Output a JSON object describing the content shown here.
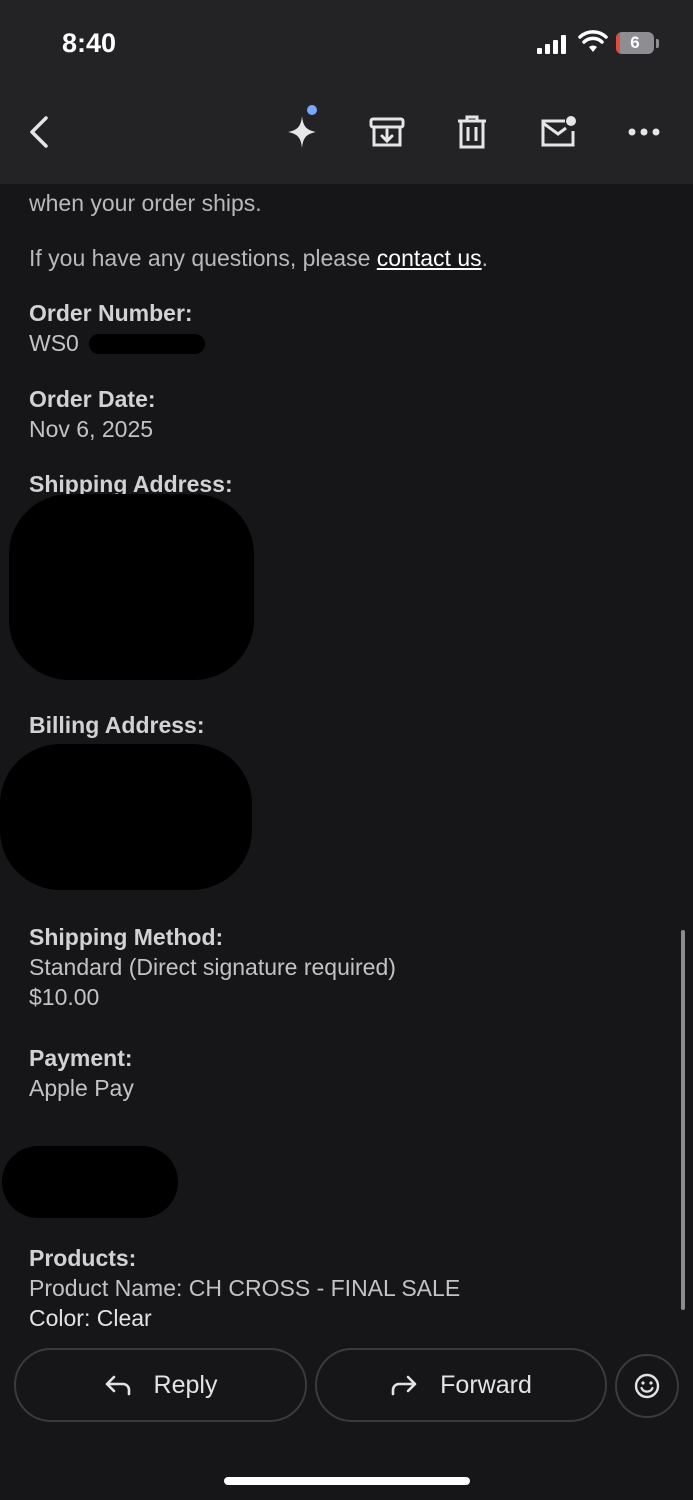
{
  "status": {
    "time": "8:40",
    "battery": "6",
    "battery_level": 0.06
  },
  "toolbar": {
    "icons": [
      "back-icon",
      "gemini-sparkle-icon",
      "archive-icon",
      "trash-icon",
      "mark-unread-icon",
      "more-icon"
    ]
  },
  "email": {
    "partial_line": "when your order ships.",
    "questions_text": "If you have any questions, please ",
    "contact_link": "contact us",
    "questions_end": ".",
    "order_number_label": "Order Number:",
    "order_number_value": "WS0",
    "order_date_label": "Order Date:",
    "order_date_value": "Nov 6, 2025",
    "shipping_address_label": "Shipping Address:",
    "billing_address_label": "Billing Address:",
    "shipping_method_label": "Shipping Method:",
    "shipping_method_value": "Standard (Direct signature required)",
    "shipping_cost": "$10.00",
    "payment_label": "Payment:",
    "payment_value": "Apple Pay",
    "products_label": "Products:",
    "product_name": "Product Name: CH CROSS - FINAL SALE",
    "product_color": "Color: Clear"
  },
  "actions": {
    "reply": "Reply",
    "forward": "Forward"
  },
  "colors": {
    "background": "#161618",
    "toolbar": "#232325",
    "link": "#ffffff",
    "battery_low": "#e04a3f"
  }
}
